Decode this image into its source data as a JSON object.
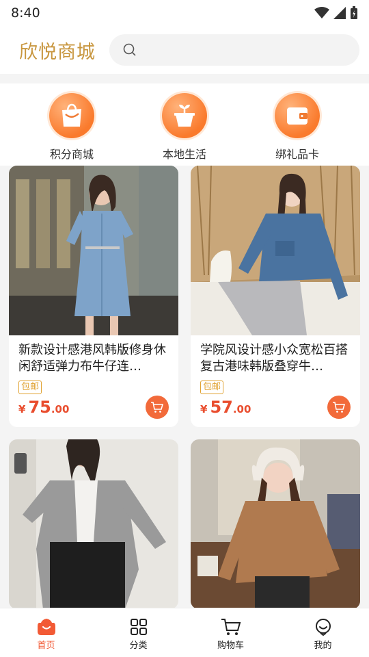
{
  "status": {
    "time": "8:40"
  },
  "header": {
    "brand": "欣悦商城",
    "search_placeholder": ""
  },
  "shortcuts": [
    {
      "label": "积分商城",
      "icon": "shopping-bag-icon"
    },
    {
      "label": "本地生活",
      "icon": "plant-pot-icon"
    },
    {
      "label": "绑礼品卡",
      "icon": "wallet-icon"
    }
  ],
  "products": [
    {
      "title": "新款设计感港风韩版修身休闲舒适弹力布牛仔连…",
      "tag": "包邮",
      "currency": "¥",
      "price_int": "75",
      "price_dec": ".00"
    },
    {
      "title": "学院风设计感小众宽松百搭复古港味韩版叠穿牛…",
      "tag": "包邮",
      "currency": "¥",
      "price_int": "57",
      "price_dec": ".00"
    },
    {
      "title": "",
      "tag": "",
      "currency": "",
      "price_int": "",
      "price_dec": ""
    },
    {
      "title": "",
      "tag": "",
      "currency": "",
      "price_int": "",
      "price_dec": ""
    }
  ],
  "tabbar": [
    {
      "label": "首页",
      "icon": "home-icon",
      "active": true
    },
    {
      "label": "分类",
      "icon": "grid-icon",
      "active": false
    },
    {
      "label": "购物车",
      "icon": "cart-icon",
      "active": false
    },
    {
      "label": "我的",
      "icon": "profile-icon",
      "active": false
    }
  ],
  "colors": {
    "brand": "#c8963e",
    "accent": "#f25a35",
    "price": "#e94d2e",
    "tag": "#e0a232"
  }
}
